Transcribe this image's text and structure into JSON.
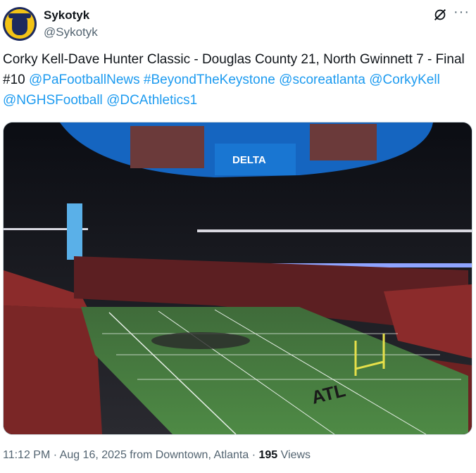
{
  "author": {
    "name": "Sykotyk",
    "handle": "@Sykotyk"
  },
  "tweet": {
    "text_plain": "Corky Kell-Dave Hunter Classic - Douglas County 21, North Gwinnett 7 - Final #10",
    "mentions": [
      "@PaFootballNews",
      "#BeyondTheKeystone",
      "@scoreatlanta",
      "@CorkyKell",
      "@NGHSFootball",
      "@DCAthletics1"
    ]
  },
  "media": {
    "banner_text": "DELTA",
    "end_zone_text": "ATL"
  },
  "footer": {
    "time": "11:12 PM",
    "date": "Aug 16, 2025",
    "location": "from Downtown, Atlanta",
    "views_count": "195",
    "views_label": "Views"
  },
  "icons": [
    "grok-icon",
    "more-icon"
  ],
  "colors": {
    "link": "#1d9bf0",
    "secondary": "#536471"
  }
}
